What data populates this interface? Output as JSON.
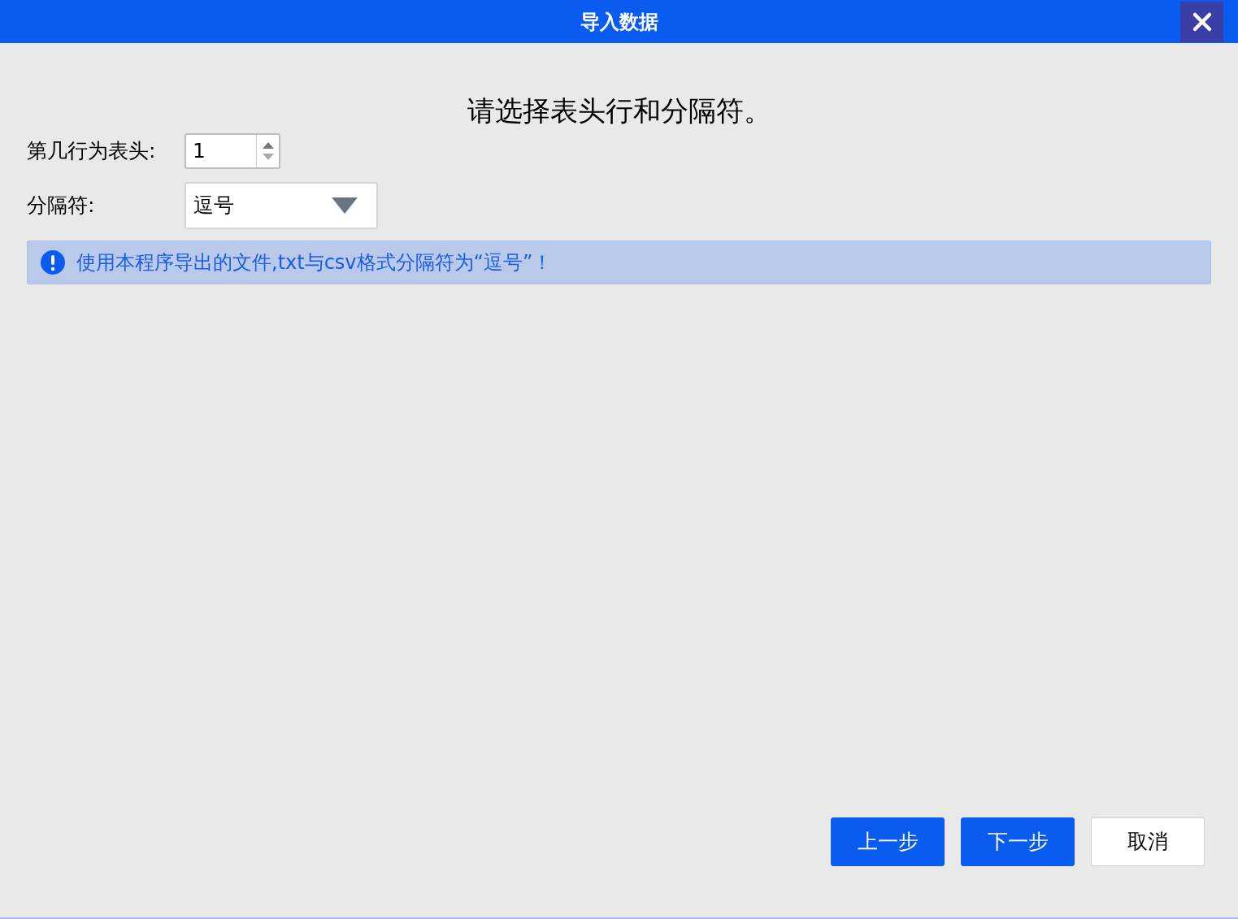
{
  "window": {
    "title": "导入数据"
  },
  "heading": "请选择表头行和分隔符。",
  "header_row": {
    "label": "第几行为表头:",
    "value": "1"
  },
  "delimiter": {
    "label": "分隔符:",
    "value": "逗号"
  },
  "notice": {
    "text": "使用本程序导出的文件,txt与csv格式分隔符为“逗号”！"
  },
  "buttons": [
    {
      "label": "上一步",
      "kind": "primary"
    },
    {
      "label": "下一步",
      "kind": "primary"
    },
    {
      "label": "取消",
      "kind": "secondary"
    }
  ]
}
